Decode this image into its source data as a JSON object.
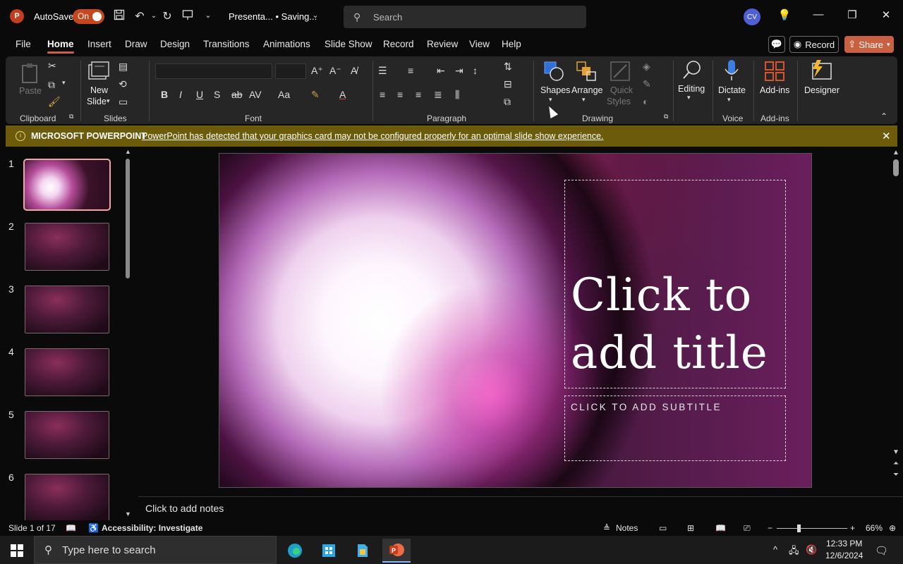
{
  "titlebar": {
    "logo": "P",
    "autosave_label": "AutoSave",
    "autosave_state": "On",
    "doc_title": "Presenta... • Saving...",
    "search_placeholder": "Search",
    "avatar_initials": "CV"
  },
  "tabs": [
    "File",
    "Home",
    "Insert",
    "Draw",
    "Design",
    "Transitions",
    "Animations",
    "Slide Show",
    "Record",
    "Review",
    "View",
    "Help"
  ],
  "active_tab": "Home",
  "header_buttons": {
    "record": "Record",
    "share": "Share"
  },
  "ribbon": {
    "groups": {
      "clipboard": "Clipboard",
      "slides": "Slides",
      "font": "Font",
      "paragraph": "Paragraph",
      "drawing": "Drawing",
      "voice": "Voice",
      "addins": "Add-ins"
    },
    "paste": "Paste",
    "new_slide": [
      "New",
      "Slide"
    ],
    "shapes": "Shapes",
    "arrange": "Arrange",
    "quick_styles": [
      "Quick",
      "Styles"
    ],
    "editing": "Editing",
    "dictate": "Dictate",
    "addins_btn": "Add-ins",
    "designer": "Designer"
  },
  "notice": {
    "heading": "MICROSOFT POWERPOINT",
    "message": "PowerPoint has detected that your graphics card may not be configured properly for an optimal slide show experience."
  },
  "thumbnails": [
    "1",
    "2",
    "3",
    "4",
    "5",
    "6"
  ],
  "slide": {
    "title_line1": "Click to",
    "title_line2": "add title",
    "subtitle": "CLICK TO ADD SUBTITLE"
  },
  "notes_placeholder": "Click to add notes",
  "status": {
    "slide_count": "Slide 1 of 17",
    "accessibility": "Accessibility: Investigate",
    "notes": "Notes",
    "zoom": "66%"
  },
  "taskbar": {
    "search_placeholder": "Type here to search",
    "time": "12:33 PM",
    "date": "12/6/2024"
  },
  "colors": {
    "accent": "#c96141",
    "notice_bg": "#6b5b0a",
    "ribbon_bg": "#262626"
  }
}
